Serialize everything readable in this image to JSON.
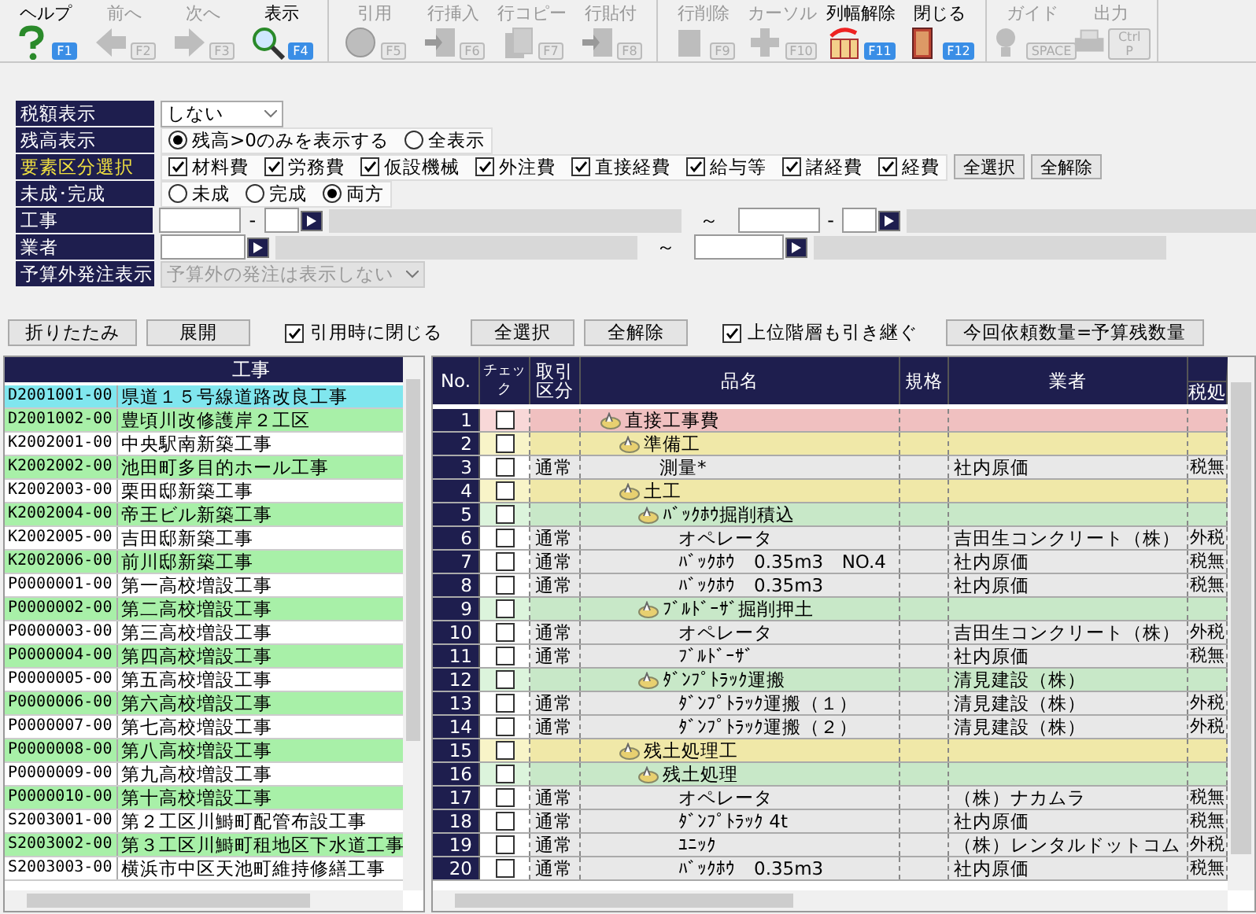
{
  "toolbar": [
    {
      "buttons": [
        {
          "label": "ヘルプ",
          "key": "F1",
          "kind": "help",
          "disabled": false
        },
        {
          "label": "前へ",
          "key": "F2",
          "kind": "back",
          "disabled": true
        },
        {
          "label": "次へ",
          "key": "F3",
          "kind": "forward",
          "disabled": true
        },
        {
          "label": "表示",
          "key": "F4",
          "kind": "search",
          "disabled": false
        }
      ]
    },
    {
      "buttons": [
        {
          "label": "引用",
          "key": "F5",
          "kind": "quote",
          "disabled": true
        },
        {
          "label": "行挿入",
          "key": "F6",
          "kind": "insert",
          "disabled": true
        },
        {
          "label": "行コピー",
          "key": "F7",
          "kind": "copy",
          "disabled": true
        },
        {
          "label": "行貼付",
          "key": "F8",
          "kind": "paste",
          "disabled": true
        }
      ]
    },
    {
      "buttons": [
        {
          "label": "行削除",
          "key": "F9",
          "kind": "delete",
          "disabled": true
        },
        {
          "label": "カーソル",
          "key": "F10",
          "kind": "cursor",
          "disabled": true
        },
        {
          "label": "列幅解除",
          "key": "F11",
          "kind": "columns",
          "disabled": false
        },
        {
          "label": "閉じる",
          "key": "F12",
          "kind": "close",
          "disabled": false
        }
      ]
    },
    {
      "buttons": [
        {
          "label": "ガイド",
          "key": "SPACE",
          "kind": "guide",
          "disabled": true
        },
        {
          "label": "出力",
          "key": "Ctrl P",
          "kind": "output",
          "disabled": true
        }
      ]
    }
  ],
  "filters": [
    {
      "label": "税額表示",
      "kind": "select",
      "highlighted": false,
      "value": "しない",
      "disabled": false
    },
    {
      "label": "残高表示",
      "kind": "radio",
      "highlighted": false,
      "options": [
        {
          "label": "残高>0のみを表示する",
          "selected": true
        },
        {
          "label": "全表示",
          "selected": false
        }
      ]
    },
    {
      "label": "要素区分選択",
      "kind": "checks",
      "highlighted": true,
      "options": [
        {
          "label": "材料費",
          "checked": true
        },
        {
          "label": "労務費",
          "checked": true
        },
        {
          "label": "仮設機械",
          "checked": true
        },
        {
          "label": "外注費",
          "checked": true
        },
        {
          "label": "直接経費",
          "checked": true
        },
        {
          "label": "給与等",
          "checked": true
        },
        {
          "label": "諸経費",
          "checked": true
        },
        {
          "label": "経費",
          "checked": true
        }
      ],
      "buttons": [
        "全選択",
        "全解除"
      ]
    },
    {
      "label": "未成･完成",
      "kind": "radio",
      "highlighted": false,
      "options": [
        {
          "label": "未成",
          "selected": false
        },
        {
          "label": "完成",
          "selected": false
        },
        {
          "label": "両方",
          "selected": true
        }
      ]
    },
    {
      "label": "工事",
      "kind": "code_range",
      "highlighted": false,
      "dash": "-",
      "tilde": "～"
    },
    {
      "label": "業者",
      "kind": "vendor_range",
      "highlighted": false,
      "tilde": "～"
    },
    {
      "label": "予算外発注表示",
      "kind": "select",
      "highlighted": false,
      "value": "予算外の発注は表示しない",
      "disabled": true
    }
  ],
  "actions": [
    {
      "kind": "button",
      "label": "折りたたみ"
    },
    {
      "kind": "button",
      "label": "展開"
    },
    {
      "kind": "checkbox",
      "label": "引用時に閉じる",
      "checked": true
    },
    {
      "kind": "button",
      "label": "全選択"
    },
    {
      "kind": "button",
      "label": "全解除"
    },
    {
      "kind": "checkbox",
      "label": "上位階層も引き継ぐ",
      "checked": true
    },
    {
      "kind": "button",
      "label": "今回依頼数量=予算残数量"
    }
  ],
  "job_list": {
    "header": "工事",
    "rows": [
      {
        "code": "D2001001-00",
        "name": "県道１５号線道路改良工事",
        "selected": true
      },
      {
        "code": "D2001002-00",
        "name": "豊頃川改修護岸２工区",
        "selected": false
      },
      {
        "code": "K2002001-00",
        "name": "中央駅南新築工事",
        "selected": false
      },
      {
        "code": "K2002002-00",
        "name": "池田町多目的ホール工事",
        "selected": false
      },
      {
        "code": "K2002003-00",
        "name": "栗田邸新築工事",
        "selected": false
      },
      {
        "code": "K2002004-00",
        "name": "帝王ビル新築工事",
        "selected": false
      },
      {
        "code": "K2002005-00",
        "name": "吉田邸新築工事",
        "selected": false
      },
      {
        "code": "K2002006-00",
        "name": "前川邸新築工事",
        "selected": false
      },
      {
        "code": "P0000001-00",
        "name": "第一高校増設工事",
        "selected": false
      },
      {
        "code": "P0000002-00",
        "name": "第二高校増設工事",
        "selected": false
      },
      {
        "code": "P0000003-00",
        "name": "第三高校増設工事",
        "selected": false
      },
      {
        "code": "P0000004-00",
        "name": "第四高校増設工事",
        "selected": false
      },
      {
        "code": "P0000005-00",
        "name": "第五高校増設工事",
        "selected": false
      },
      {
        "code": "P0000006-00",
        "name": "第六高校増設工事",
        "selected": false
      },
      {
        "code": "P0000007-00",
        "name": "第七高校増設工事",
        "selected": false
      },
      {
        "code": "P0000008-00",
        "name": "第八高校増設工事",
        "selected": false
      },
      {
        "code": "P0000009-00",
        "name": "第九高校増設工事",
        "selected": false
      },
      {
        "code": "P0000010-00",
        "name": "第十高校増設工事",
        "selected": false
      },
      {
        "code": "S2003001-00",
        "name": "第２工区川鰣町配管布設工事",
        "selected": false
      },
      {
        "code": "S2003002-00",
        "name": "第３工区川鰣町租地区下水道工事",
        "selected": false
      },
      {
        "code": "S2003003-00",
        "name": "横浜市中区天池町維持修繕工事",
        "selected": false
      }
    ]
  },
  "detail_table": {
    "columns": [
      "No.",
      "チェック",
      "取引区分",
      "品名",
      "規格",
      "業者",
      "税処"
    ],
    "rows": [
      {
        "no": "1",
        "kind": "group",
        "name": "直接工事費",
        "checked": false,
        "children": [
          {
            "no": "2",
            "kind": "group",
            "name": "準備工",
            "checked": false,
            "children": [
              {
                "no": "3",
                "kind": "item",
                "type": "通常",
                "name": "測量*",
                "vendor": "社内原価",
                "tax": "税無",
                "checked": false
              }
            ]
          },
          {
            "no": "4",
            "kind": "group",
            "name": "土工",
            "checked": false,
            "children": [
              {
                "no": "5",
                "kind": "group",
                "name": "ﾊﾞｯｸﾎｳ掘削積込",
                "checked": false,
                "children": [
                  {
                    "no": "6",
                    "kind": "item",
                    "type": "通常",
                    "name": "オペレータ",
                    "vendor": "吉田生コンクリート（株）",
                    "tax": "外税",
                    "checked": false
                  },
                  {
                    "no": "7",
                    "kind": "item",
                    "type": "通常",
                    "name": "ﾊﾞｯｸﾎｳ　0.35m3",
                    "note": "NO.4",
                    "vendor": "社内原価",
                    "tax": "税無",
                    "checked": false
                  },
                  {
                    "no": "8",
                    "kind": "item",
                    "type": "通常",
                    "name": "ﾊﾞｯｸﾎｳ　0.35m3",
                    "vendor": "社内原価",
                    "tax": "税無",
                    "checked": false
                  }
                ]
              },
              {
                "no": "9",
                "kind": "group",
                "name": "ﾌﾞﾙﾄﾞｰｻﾞ掘削押土",
                "checked": false,
                "children": [
                  {
                    "no": "10",
                    "kind": "item",
                    "type": "通常",
                    "name": "オペレータ",
                    "vendor": "吉田生コンクリート（株）",
                    "tax": "外税",
                    "checked": false
                  },
                  {
                    "no": "11",
                    "kind": "item",
                    "type": "通常",
                    "name": "ﾌﾞﾙﾄﾞｰｻﾞ",
                    "vendor": "社内原価",
                    "tax": "税無",
                    "checked": false
                  }
                ]
              },
              {
                "no": "12",
                "kind": "group",
                "name": "ﾀﾞﾝﾌﾟﾄﾗｯｸ運搬",
                "vendor": "清見建設（株）",
                "checked": false,
                "children": [
                  {
                    "no": "13",
                    "kind": "item",
                    "type": "通常",
                    "name": "ﾀﾞﾝﾌﾟﾄﾗｯｸ運搬（１）",
                    "vendor": "清見建設（株）",
                    "tax": "外税",
                    "checked": false
                  },
                  {
                    "no": "14",
                    "kind": "item",
                    "type": "通常",
                    "name": "ﾀﾞﾝﾌﾟﾄﾗｯｸ運搬（２）",
                    "vendor": "清見建設（株）",
                    "tax": "外税",
                    "checked": false
                  }
                ]
              }
            ]
          },
          {
            "no": "15",
            "kind": "group",
            "name": "残土処理工",
            "checked": false,
            "children": [
              {
                "no": "16",
                "kind": "group",
                "name": "残土処理",
                "checked": false,
                "children": [
                  {
                    "no": "17",
                    "kind": "item",
                    "type": "通常",
                    "name": "オペレータ",
                    "vendor": "（株）ナカムラ",
                    "tax": "税無",
                    "checked": false
                  },
                  {
                    "no": "18",
                    "kind": "item",
                    "type": "通常",
                    "name": "ﾀﾞﾝﾌﾟﾄﾗｯｸ 4t",
                    "vendor": "社内原価",
                    "tax": "税無",
                    "checked": false
                  },
                  {
                    "no": "19",
                    "kind": "item",
                    "type": "通常",
                    "name": "ﾕﾆｯｸ",
                    "vendor": "（株）レンタルドットコム",
                    "tax": "外税",
                    "checked": false
                  },
                  {
                    "no": "20",
                    "kind": "item",
                    "type": "通常",
                    "name": "ﾊﾞｯｸﾎｳ　0.35m3",
                    "vendor": "社内原価",
                    "tax": "税無",
                    "checked": false
                  }
                ]
              }
            ]
          }
        ]
      }
    ]
  }
}
